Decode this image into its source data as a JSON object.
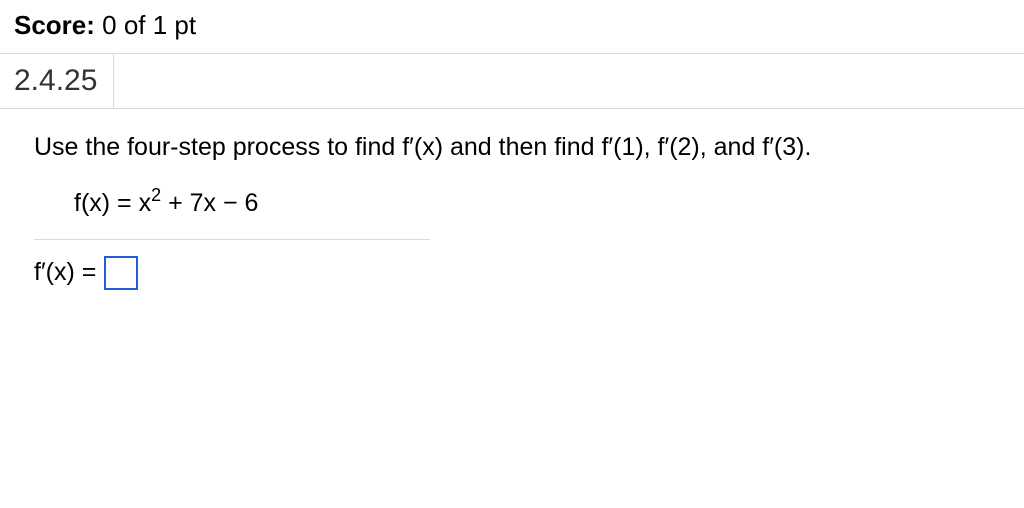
{
  "score": {
    "label": "Score:",
    "value": "0 of 1 pt"
  },
  "question_number": "2.4.25",
  "instruction": "Use the four-step process to find f′(x) and then find f′(1), f′(2), and f′(3).",
  "equation": {
    "lhs": "f(x) =",
    "rhs_pre": "x",
    "rhs_sup": "2",
    "rhs_post": " + 7x − 6"
  },
  "answer": {
    "label": "f′(x) =",
    "value": ""
  }
}
